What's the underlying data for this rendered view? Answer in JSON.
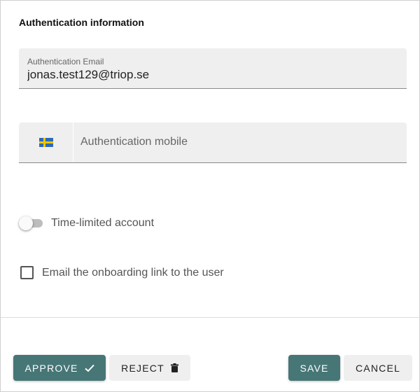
{
  "section": {
    "title": "Authentication information"
  },
  "email": {
    "label": "Authentication Email",
    "value": "jonas.test129@triop.se"
  },
  "mobile": {
    "country_flag": "sweden-flag-icon",
    "placeholder": "Authentication mobile"
  },
  "time_limited": {
    "label": "Time-limited account",
    "enabled": false
  },
  "onboarding": {
    "label": "Email the onboarding link to the user",
    "checked": false
  },
  "actions": {
    "approve_label": "APPROVE",
    "reject_label": "REJECT",
    "save_label": "SAVE",
    "cancel_label": "CANCEL"
  },
  "colors": {
    "primary": "#477676",
    "secondary_bg": "#efefef",
    "field_bg": "#efefef"
  }
}
